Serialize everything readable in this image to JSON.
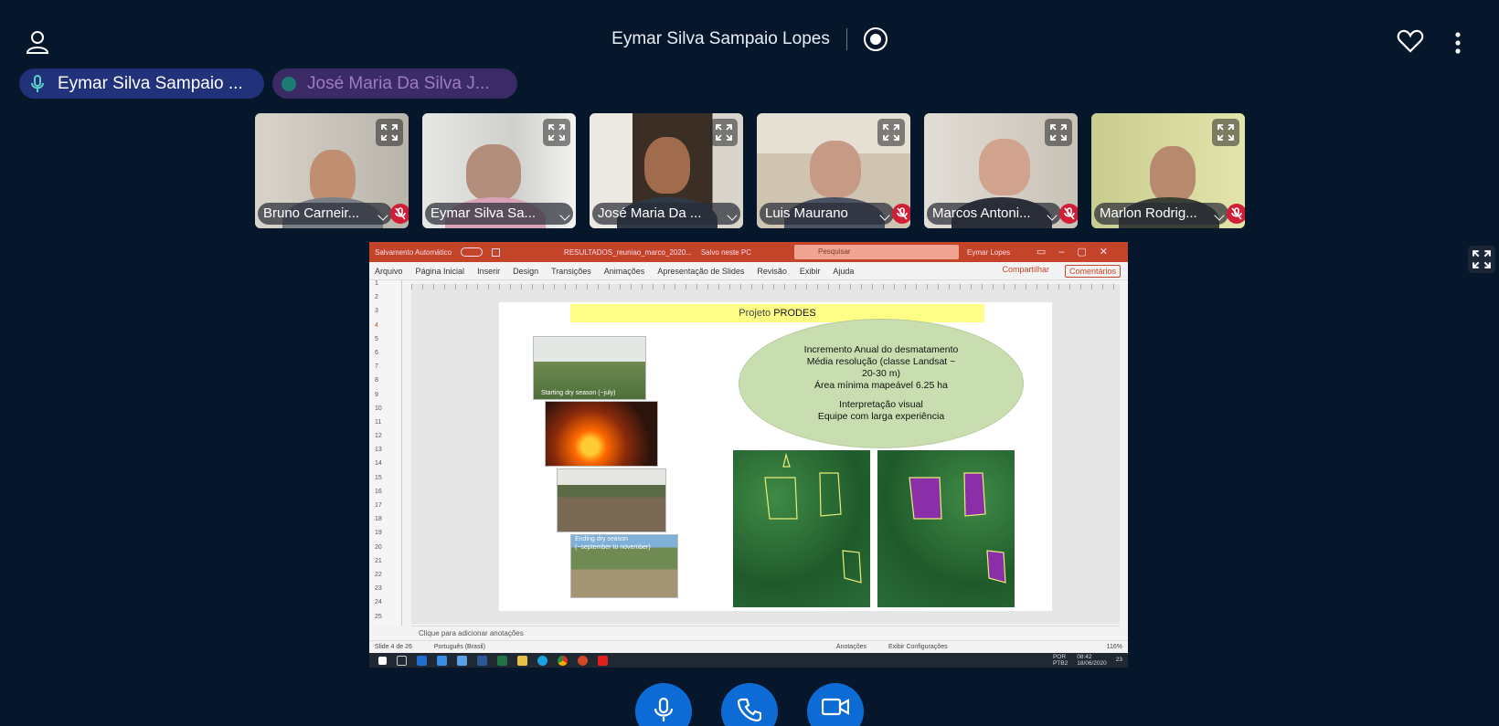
{
  "header": {
    "meeting_title": "Eymar Silva Sampaio Lopes"
  },
  "talkers": [
    {
      "name": "Eymar Silva Sampaio ...",
      "state": "speaking"
    },
    {
      "name": "José Maria Da Silva J...",
      "state": "inactive"
    }
  ],
  "participants": [
    {
      "name": "Bruno Carneir...",
      "muted": true
    },
    {
      "name": "Eymar Silva Sa...",
      "muted": false
    },
    {
      "name": "José Maria Da ...",
      "muted": false
    },
    {
      "name": "Luis Maurano",
      "muted": true
    },
    {
      "name": "Marcos Antoni...",
      "muted": true
    },
    {
      "name": "Marlon Rodrig...",
      "muted": true
    }
  ],
  "screenshare": {
    "ppt": {
      "autosave": "Salvamento Automático",
      "file": "RESULTADOS_reuniao_marco_2020...",
      "saved": "Salvo neste PC",
      "search_placeholder": "Pesquisar",
      "user": "Eymar Lopes",
      "menu": [
        "Arquivo",
        "Página Inicial",
        "Inserir",
        "Design",
        "Transições",
        "Animações",
        "Apresentação de Slides",
        "Revisão",
        "Exibir",
        "Ajuda"
      ],
      "share": "Compartilhar",
      "comments": "Comentários",
      "thumb_numbers": [
        "1",
        "2",
        "3",
        "4",
        "5",
        "6",
        "7",
        "8",
        "9",
        "10",
        "11",
        "12",
        "13",
        "14",
        "15",
        "16",
        "17",
        "18",
        "19",
        "20",
        "21",
        "22",
        "23",
        "24",
        "25"
      ],
      "notes_placeholder": "Clique para adicionar anotações",
      "status_slide": "Slide 4 de 26",
      "status_lang": "Português (Brasil)",
      "status_notes": "Anotações",
      "status_display": "Exibir Configurações",
      "zoom": "116%",
      "tray_lang": "POR",
      "tray_kbd": "PTB2",
      "tray_time": "08:42",
      "tray_date": "18/06/2020",
      "tray_count": "23"
    },
    "slide": {
      "title_prefix": "Projeto",
      "title_main": "PRODES",
      "ellipse_lines": [
        "Incremento Anual do desmatamento",
        "Média resolução (classe Landsat ~",
        "20-30 m)",
        "Área mínima mapeável 6.25 ha",
        "",
        "Interpretação visual",
        "Equipe com larga experiência"
      ],
      "photo1_caption": "Starting dry season (~july)",
      "photo4_caption_1": "Ending dry season",
      "photo4_caption_2": "(~september to november)"
    }
  },
  "colors": {
    "background": "#06172b",
    "call_button": "#0d6bd6",
    "mute_badge": "#d21d37",
    "ppt_red": "#c4442a"
  }
}
